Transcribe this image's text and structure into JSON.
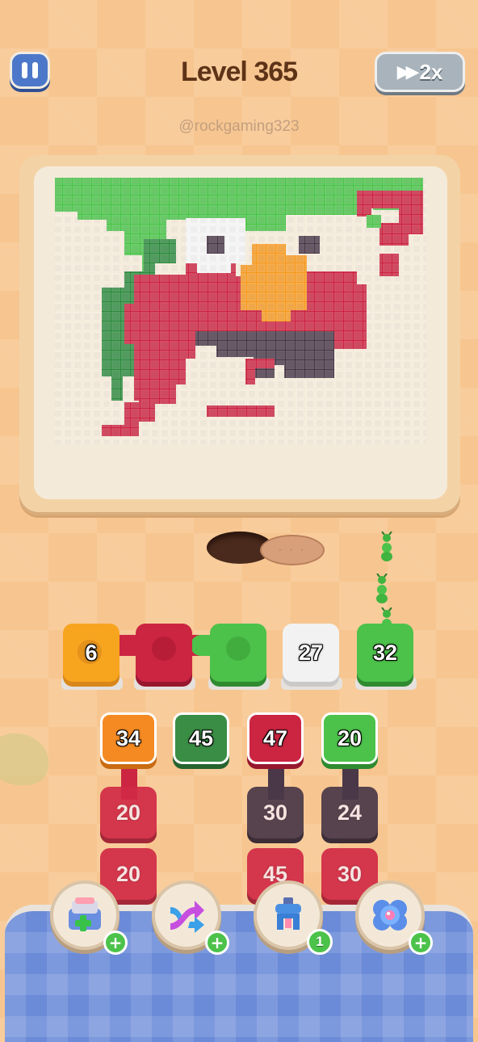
{
  "header": {
    "level_label": "Level 365",
    "speed_label": "2x"
  },
  "watermark": "@rockgaming323",
  "colors": {
    "green": "#4cc24a",
    "dark_green": "#3a8d45",
    "red": "#c9243f",
    "orange": "#f5a623",
    "white": "#f4f4f4",
    "purple": "#4a3848"
  },
  "conveyor_slots": [
    {
      "value": "6",
      "color": "orange"
    },
    {
      "value": "",
      "color": "red"
    },
    {
      "value": "",
      "color": "green"
    },
    {
      "value": "27",
      "color": "white"
    },
    {
      "value": "32",
      "color": "green"
    }
  ],
  "queue_columns": [
    {
      "top": "34",
      "top_color": "orange",
      "below": [
        {
          "value": "20",
          "color": "red"
        },
        {
          "value": "20",
          "color": "red"
        }
      ]
    },
    {
      "top": "45",
      "top_color": "dark_green",
      "below": []
    },
    {
      "top": "47",
      "top_color": "red",
      "below": [
        {
          "value": "30",
          "color": "purple"
        },
        {
          "value": "45",
          "color": "red"
        }
      ]
    },
    {
      "top": "20",
      "top_color": "green",
      "below": [
        {
          "value": "24",
          "color": "purple"
        },
        {
          "value": "30",
          "color": "red"
        }
      ]
    }
  ],
  "boosters": [
    {
      "name": "add-slot",
      "icon": "crate-plus-icon",
      "badge": "+"
    },
    {
      "name": "shuffle",
      "icon": "shuffle-arrows-icon",
      "badge": "+"
    },
    {
      "name": "grabber",
      "icon": "claw-magnet-icon",
      "badge": "1"
    },
    {
      "name": "bubble",
      "icon": "bubble-icon",
      "badge": "+"
    }
  ]
}
